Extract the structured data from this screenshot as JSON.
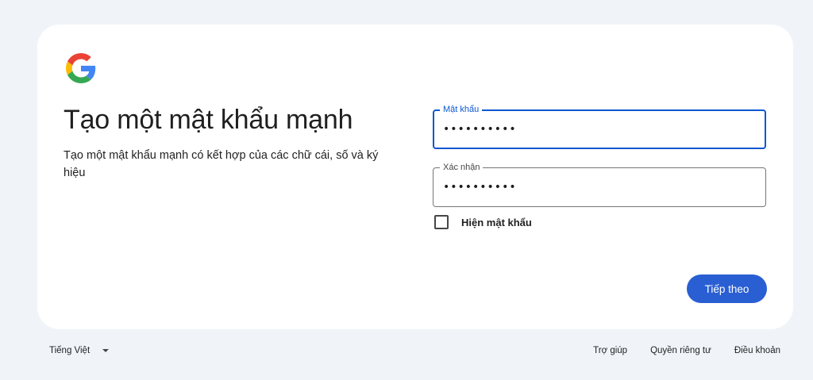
{
  "header": {
    "logo": "google-g-logo"
  },
  "main": {
    "title": "Tạo một mật khẩu mạnh",
    "subtitle": "Tạo một mật khẩu mạnh có kết hợp của các chữ cái, số và ký hiệu"
  },
  "form": {
    "password": {
      "label": "Mật khẩu",
      "value": "••••••••••"
    },
    "confirm": {
      "label": "Xác nhận",
      "value": "••••••••••"
    },
    "show_password_label": "Hiện mật khẩu",
    "show_password_checked": false,
    "next_label": "Tiếp theo"
  },
  "footer": {
    "language": "Tiếng Việt",
    "links": {
      "help": "Trợ giúp",
      "privacy": "Quyền riêng tư",
      "terms": "Điều khoản"
    }
  },
  "colors": {
    "background": "#f0f4f9",
    "card": "#ffffff",
    "accent": "#0b57d0",
    "button": "#2a5fd3"
  }
}
